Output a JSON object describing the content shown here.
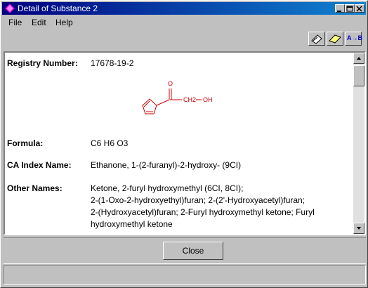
{
  "window": {
    "title": "Detail of Substance 2"
  },
  "menu": {
    "file": "File",
    "edit": "Edit",
    "help": "Help"
  },
  "toolbar": {
    "icons": [
      "clear-icon",
      "eraser-icon",
      "ab-icon"
    ],
    "ab_label": "A→B"
  },
  "substance": {
    "registry_label": "Registry Number:",
    "registry_value": "17678-19-2",
    "structure": {
      "o_label": "O",
      "ch2_label": "CH2",
      "oh_label": "OH",
      "ring_o_label": "O"
    },
    "formula_label": "Formula:",
    "formula_value": "C6 H6 O3",
    "ca_index_label": "CA Index Name:",
    "ca_index_value": "Ethanone, 1-(2-furanyl)-2-hydroxy- (9CI)",
    "other_names_label": "Other Names:",
    "other_names_lines": [
      "Ketone, 2-furyl hydroxymethyl (6CI, 8CI);",
      "2-(1-Oxo-2-hydroxyethyl)furan; 2-(2'-Hydroxyacetyl)furan;",
      "2-(Hydroxyacetyl)furan; 2-Furyl hydroxymethyl ketone; Furyl",
      "hydroxymethyl ketone"
    ]
  },
  "buttons": {
    "close": "Close"
  },
  "colors": {
    "title_bar": "#000080",
    "structure": "#cc0000"
  }
}
